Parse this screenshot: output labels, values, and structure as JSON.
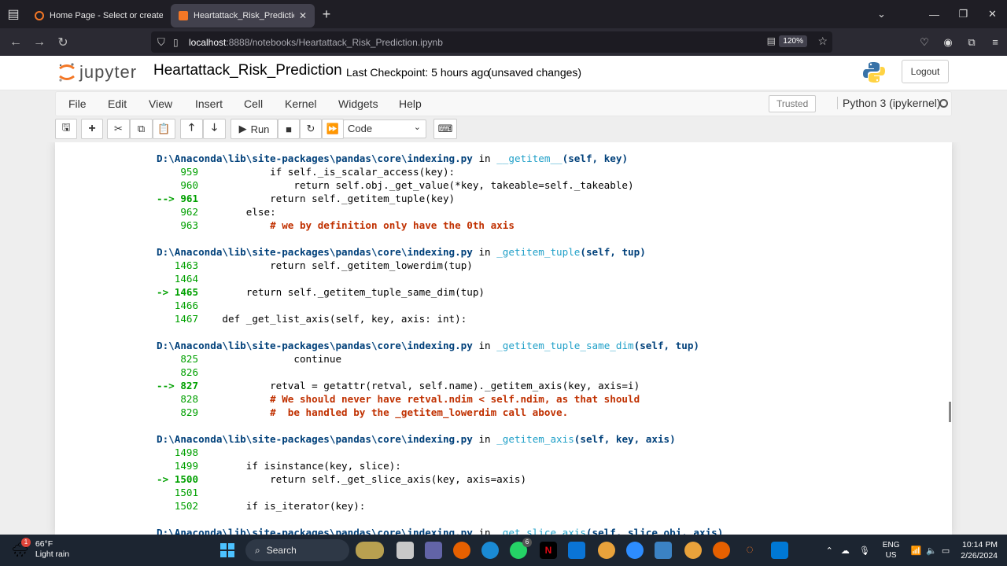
{
  "browser": {
    "tabs": [
      {
        "title": "Home Page - Select or create a",
        "active": false
      },
      {
        "title": "Heartattack_Risk_Prediction - Ju",
        "active": true
      }
    ],
    "url_host": "localhost",
    "url_path": ":8888/notebooks/Heartattack_Risk_Prediction.ipynb",
    "zoom": "120%"
  },
  "jupyter": {
    "logo_text": "jupyter",
    "notebook_name": "Heartattack_Risk_Prediction",
    "checkpoint": "Last Checkpoint: 5 hours ago",
    "save_status": "(unsaved changes)",
    "logout_label": "Logout",
    "menu": [
      "File",
      "Edit",
      "View",
      "Insert",
      "Cell",
      "Kernel",
      "Widgets",
      "Help"
    ],
    "trusted_label": "Trusted",
    "kernel_name": "Python 3 (ipykernel)",
    "toolbar": {
      "run_label": "Run",
      "cell_type": "Code"
    }
  },
  "traceback": [
    {
      "type": "header",
      "path": "D:\\Anaconda\\lib\\site-packages\\pandas\\core\\indexing.py",
      "in": "in",
      "func": "__getitem__",
      "args": "(self, key)"
    },
    {
      "type": "code",
      "no": "    959",
      "code": "            if self._is_scalar_access(key):"
    },
    {
      "type": "code",
      "no": "    960",
      "code": "                return self.obj._get_value(*key, takeable=self._takeable)"
    },
    {
      "type": "current",
      "no": "--> 961",
      "code": "            return self._getitem_tuple(key)"
    },
    {
      "type": "code",
      "no": "    962",
      "code": "        else:"
    },
    {
      "type": "comment",
      "no": "    963",
      "code": "            # we by definition only have the 0th axis"
    },
    {
      "type": "blank"
    },
    {
      "type": "header",
      "path": "D:\\Anaconda\\lib\\site-packages\\pandas\\core\\indexing.py",
      "in": "in",
      "func": "_getitem_tuple",
      "args": "(self, tup)"
    },
    {
      "type": "code",
      "no": "   1463",
      "code": "            return self._getitem_lowerdim(tup)"
    },
    {
      "type": "code",
      "no": "   1464",
      "code": ""
    },
    {
      "type": "current",
      "no": "-> 1465",
      "code": "        return self._getitem_tuple_same_dim(tup)"
    },
    {
      "type": "code",
      "no": "   1466",
      "code": ""
    },
    {
      "type": "code",
      "no": "   1467",
      "code": "    def _get_list_axis(self, key, axis: int):"
    },
    {
      "type": "blank"
    },
    {
      "type": "header",
      "path": "D:\\Anaconda\\lib\\site-packages\\pandas\\core\\indexing.py",
      "in": "in",
      "func": "_getitem_tuple_same_dim",
      "args": "(self, tup)"
    },
    {
      "type": "code",
      "no": "    825",
      "code": "                continue"
    },
    {
      "type": "code",
      "no": "    826",
      "code": ""
    },
    {
      "type": "current",
      "no": "--> 827",
      "code": "            retval = getattr(retval, self.name)._getitem_axis(key, axis=i)"
    },
    {
      "type": "comment",
      "no": "    828",
      "code": "            # We should never have retval.ndim < self.ndim, as that should"
    },
    {
      "type": "comment",
      "no": "    829",
      "code": "            #  be handled by the _getitem_lowerdim call above."
    },
    {
      "type": "blank"
    },
    {
      "type": "header",
      "path": "D:\\Anaconda\\lib\\site-packages\\pandas\\core\\indexing.py",
      "in": "in",
      "func": "_getitem_axis",
      "args": "(self, key, axis)"
    },
    {
      "type": "code",
      "no": "   1498",
      "code": ""
    },
    {
      "type": "code",
      "no": "   1499",
      "code": "        if isinstance(key, slice):"
    },
    {
      "type": "current",
      "no": "-> 1500",
      "code": "            return self._get_slice_axis(key, axis=axis)"
    },
    {
      "type": "code",
      "no": "   1501",
      "code": ""
    },
    {
      "type": "code",
      "no": "   1502",
      "code": "        if is_iterator(key):"
    },
    {
      "type": "blank"
    },
    {
      "type": "header",
      "path": "D:\\Anaconda\\lib\\site-packages\\pandas\\core\\indexing.py",
      "in": "in",
      "func": "_get_slice_axis",
      "args": "(self, slice_obj, axis)"
    }
  ],
  "taskbar": {
    "weather_temp": "66°F",
    "weather_desc": "Light rain",
    "weather_badge": "1",
    "search_label": "Search",
    "whatsapp_badge": "6",
    "lang_1": "ENG",
    "lang_2": "US",
    "time": "10:14 PM",
    "date": "2/26/2024"
  },
  "colors": {
    "path": "#00407a",
    "function": "#20a0c8",
    "line_number": "#00a000",
    "comment": "#c03000",
    "accent_jupyter": "#f37726"
  }
}
